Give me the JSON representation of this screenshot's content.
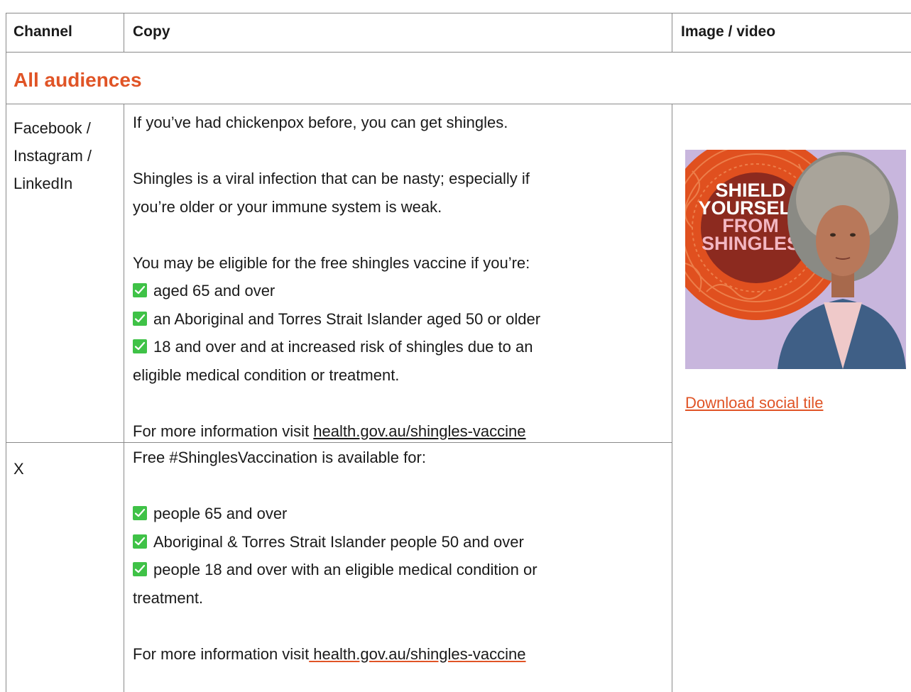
{
  "header": {
    "channel": "Channel",
    "copy": "Copy",
    "image_video": "Image / video"
  },
  "section_title": "All audiences",
  "rows": [
    {
      "channel": [
        "Facebook /",
        "Instagram /",
        "LinkedIn"
      ],
      "intro": "If you’ve had chickenpox before, you can get shingles.",
      "para2_line1": "Shingles is a viral infection that can be nasty; especially if",
      "para2_line2": "you’re older or your immune system is weak.",
      "eligible_intro": "You may be eligible for the free shingles vaccine if you’re:",
      "items": [
        "aged 65 and over",
        "an Aboriginal and Torres Strait Islander aged 50 or older",
        "18 and over and at increased risk of shingles due to an"
      ],
      "items_continuation": "eligible medical condition or treatment.",
      "more_info": "For more information visit ",
      "link": "health.gov.au/shingles-vaccine"
    },
    {
      "channel": [
        "X"
      ],
      "intro": "Free #ShinglesVaccination is available for:",
      "items": [
        "people 65 and over",
        "Aboriginal & Torres Strait Islander people 50 and over",
        "people 18 and over with an eligible medical condition or"
      ],
      "items_continuation": "treatment.",
      "more_info": "For more information visit",
      "link": " health.gov.au/shingles-vaccine "
    }
  ],
  "social_tile": {
    "headline": [
      "SHIELD",
      "YOURSELF",
      "FROM",
      "SHINGLES"
    ],
    "download_label": "Download social tile",
    "colors": {
      "background": "#c8b6dd",
      "orange": "#e0501f",
      "disc": "#8c2a1f",
      "text_white": "#ffffff",
      "text_pink": "#f3b7c2"
    }
  },
  "colors": {
    "accent": "#e05426",
    "border": "#8a8a8a",
    "check_green": "#3fc247"
  }
}
